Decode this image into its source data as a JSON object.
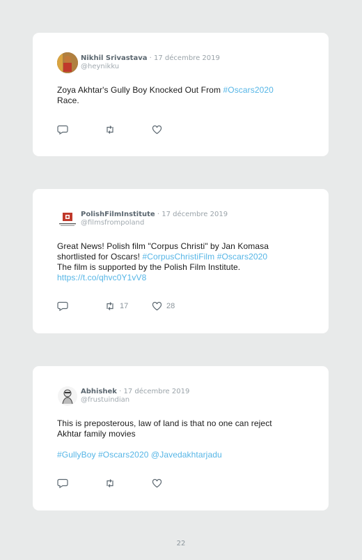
{
  "tweets": [
    {
      "name": "Nikhil Srivastava",
      "date": "· 17 décembre 2019",
      "handle": "@heynikku",
      "text_plain": "Zoya Akhtar's Gully Boy Knocked Out From ",
      "text_link": "#Oscars2020",
      "text_after": "Race.",
      "retweets": "",
      "likes": ""
    },
    {
      "name": "PolishFilmInstitute",
      "date": "· 17 décembre 2019",
      "handle": "@filmsfrompoland",
      "line1": "Great News! Polish film \"Corpus Christi\" by Jan Komasa",
      "line2_plain": "shortlisted for Oscars! ",
      "line2_link1": "#CorpusChristiFilm",
      "line2_link2": "#Oscars2020",
      "line3": "The film is supported by the Polish Film Institute.",
      "line4_link": "https://t.co/qhvc0Y1vV8",
      "retweets": "17",
      "likes": "28"
    },
    {
      "name": "Abhishek",
      "date": "· 17 décembre 2019",
      "handle": "@frustuindian",
      "line1": "This is preposterous, law of land is that no one can reject",
      "line2": "Akhtar family movies",
      "tags": "#GullyBoy #Oscars2020 @Javedakhtarjadu",
      "retweets": "",
      "likes": ""
    }
  ],
  "page_number": "22",
  "colors": {
    "link": "#55b5e6",
    "background": "#e8eaea",
    "card": "#ffffff"
  },
  "icons": [
    "reply-icon",
    "retweet-icon",
    "like-icon"
  ]
}
